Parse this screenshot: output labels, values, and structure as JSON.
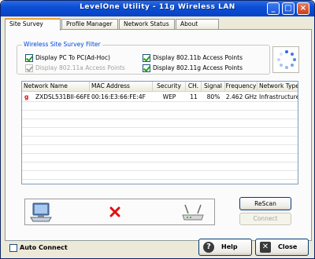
{
  "window": {
    "title": "LevelOne Utility - 11g Wireless LAN",
    "minimize": "_",
    "maximize": "□",
    "close": "×"
  },
  "tabs": [
    {
      "label": "Site Survey",
      "active": true
    },
    {
      "label": "Profile Manager",
      "active": false
    },
    {
      "label": "Network Status",
      "active": false
    },
    {
      "label": "About",
      "active": false
    }
  ],
  "filter": {
    "title": "Wireless Site Survey Filter",
    "options": [
      {
        "label": "Display PC To PC(Ad-Hoc)",
        "checked": true,
        "enabled": true
      },
      {
        "label": "Display 802.11b Access Points",
        "checked": true,
        "enabled": true
      },
      {
        "label": "Display 802.11a Access Points",
        "checked": true,
        "enabled": false
      },
      {
        "label": "Display 802.11g Access Points",
        "checked": true,
        "enabled": true
      }
    ]
  },
  "networks": {
    "headers": [
      "Network Name",
      "MAC Address",
      "Security",
      "CH.",
      "Signal",
      "Frequency",
      "Network Type"
    ],
    "rows": [
      {
        "mode": "g",
        "name": "ZXDSL531BII-66FE...",
        "mac": "00:16:E3:66:FE:4F",
        "security": "WEP",
        "channel": "11",
        "signal": "80%",
        "frequency": "2.462 GHz",
        "type": "Infrastructure"
      }
    ]
  },
  "connection": {
    "pc_icon": "computer-icon",
    "status_icon": "red-x-icon",
    "ap_icon": "router-icon",
    "status_color": "#e01010"
  },
  "buttons": {
    "rescan": "ReScan",
    "connect": "Connect",
    "help": "Help",
    "close": "Close"
  },
  "auto_connect": {
    "label": "Auto Connect",
    "checked": false
  },
  "colors": {
    "titlebar": "#0a4fd6",
    "accent_tab": "#e8a33b",
    "group_title": "#0046d5",
    "mode_marker": "#d01010"
  }
}
